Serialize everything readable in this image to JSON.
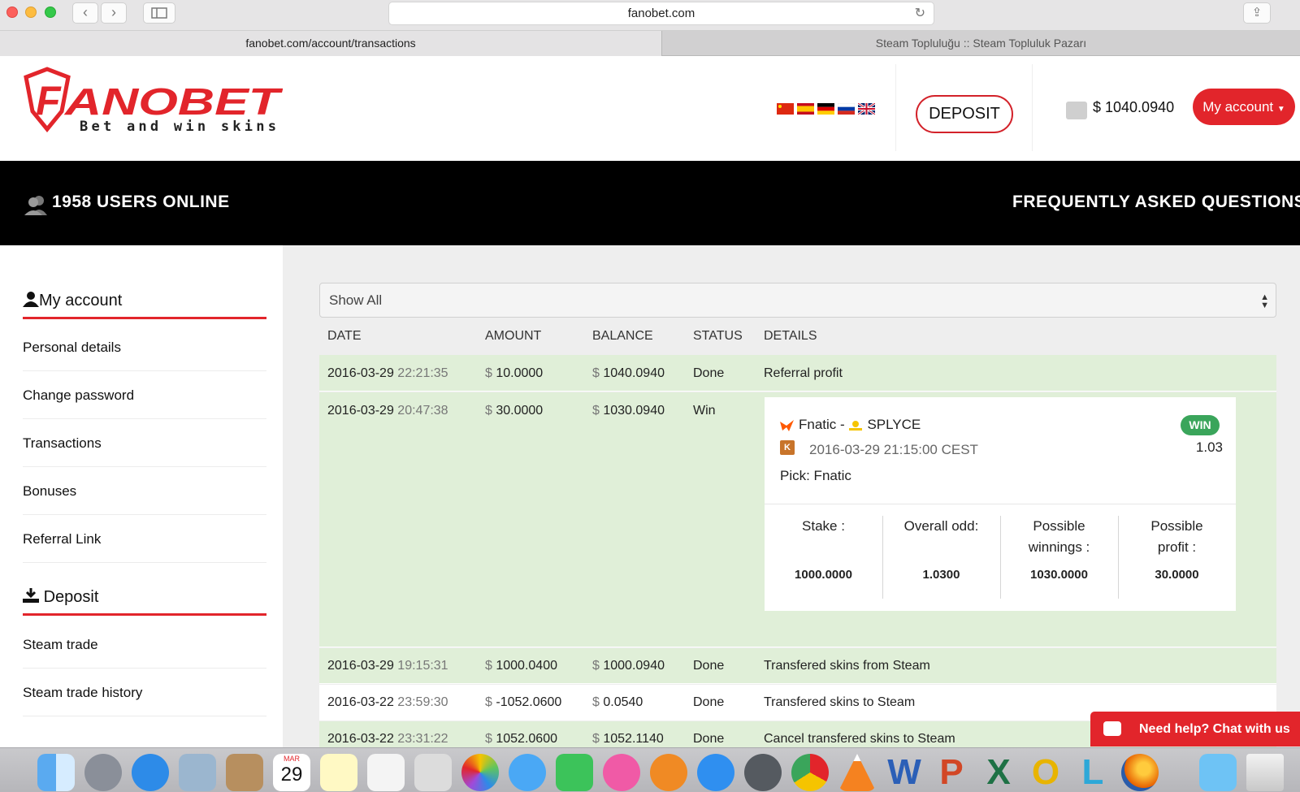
{
  "browser": {
    "url": "fanobet.com",
    "tabs": [
      {
        "label": "fanobet.com/account/transactions"
      },
      {
        "label": "Steam Topluluğu :: Steam Topluluk Pazarı"
      }
    ]
  },
  "header": {
    "logo_text": "FANOBET",
    "logo_tagline": "Bet and win skins",
    "deposit_label": "DEPOSIT",
    "balance": "$ 1040.0940",
    "myaccount_label": "My account"
  },
  "bar": {
    "users_online": "1958 USERS ONLINE",
    "faq": "FREQUENTLY ASKED QUESTIONS"
  },
  "sidebar": {
    "account_heading": "My account",
    "account_items": [
      {
        "label": "Personal details"
      },
      {
        "label": "Change password"
      },
      {
        "label": "Transactions"
      },
      {
        "label": "Bonuses"
      },
      {
        "label": "Referral Link"
      }
    ],
    "deposit_heading": "Deposit",
    "deposit_items": [
      {
        "label": "Steam trade"
      },
      {
        "label": "Steam trade history"
      }
    ]
  },
  "filter": {
    "selected": "Show All"
  },
  "table": {
    "columns": [
      "DATE",
      "AMOUNT",
      "BALANCE",
      "STATUS",
      "DETAILS"
    ],
    "rows": [
      {
        "date": "2016-03-29",
        "time": "22:21:35",
        "amount": "10.0000",
        "balance": "1040.0940",
        "status": "Done",
        "details": "Referral profit"
      },
      {
        "date": "2016-03-29",
        "time": "20:47:38",
        "amount": "30.0000",
        "balance": "1030.0940",
        "status": "Win",
        "details": ""
      },
      {
        "date": "2016-03-29",
        "time": "19:15:31",
        "amount": "1000.0400",
        "balance": "1000.0940",
        "status": "Done",
        "details": "Transfered skins from Steam"
      },
      {
        "date": "2016-03-22",
        "time": "23:59:30",
        "amount": "-1052.0600",
        "balance": "0.0540",
        "status": "Done",
        "details": "Transfered skins to Steam"
      },
      {
        "date": "2016-03-22",
        "time": "23:31:22",
        "amount": "1052.0600",
        "balance": "1052.1140",
        "status": "Done",
        "details": "Cancel transfered skins to Steam"
      }
    ],
    "currency": "$"
  },
  "bet": {
    "team1": "Fnatic",
    "team2": "SPLYCE",
    "separator": "-",
    "match_time": "2016-03-29 21:15:00 CEST",
    "pick": "Pick: Fnatic",
    "result_badge": "WIN",
    "odd": "1.03",
    "stats": [
      {
        "label": "Stake :",
        "value": "1000.0000"
      },
      {
        "label": "Overall odd:",
        "value": "1.0300"
      },
      {
        "label": "Possible winnings :",
        "value": "1030.0000"
      },
      {
        "label": "Possible profit :",
        "value": "30.0000"
      }
    ]
  },
  "chat": {
    "label": "Need help? Chat with us"
  },
  "dock_calendar": {
    "month": "MAR",
    "day": "29"
  },
  "colors": {
    "brand_red": "#e2252b",
    "row_green": "#e0efd8",
    "win_green": "#3aa55b"
  }
}
